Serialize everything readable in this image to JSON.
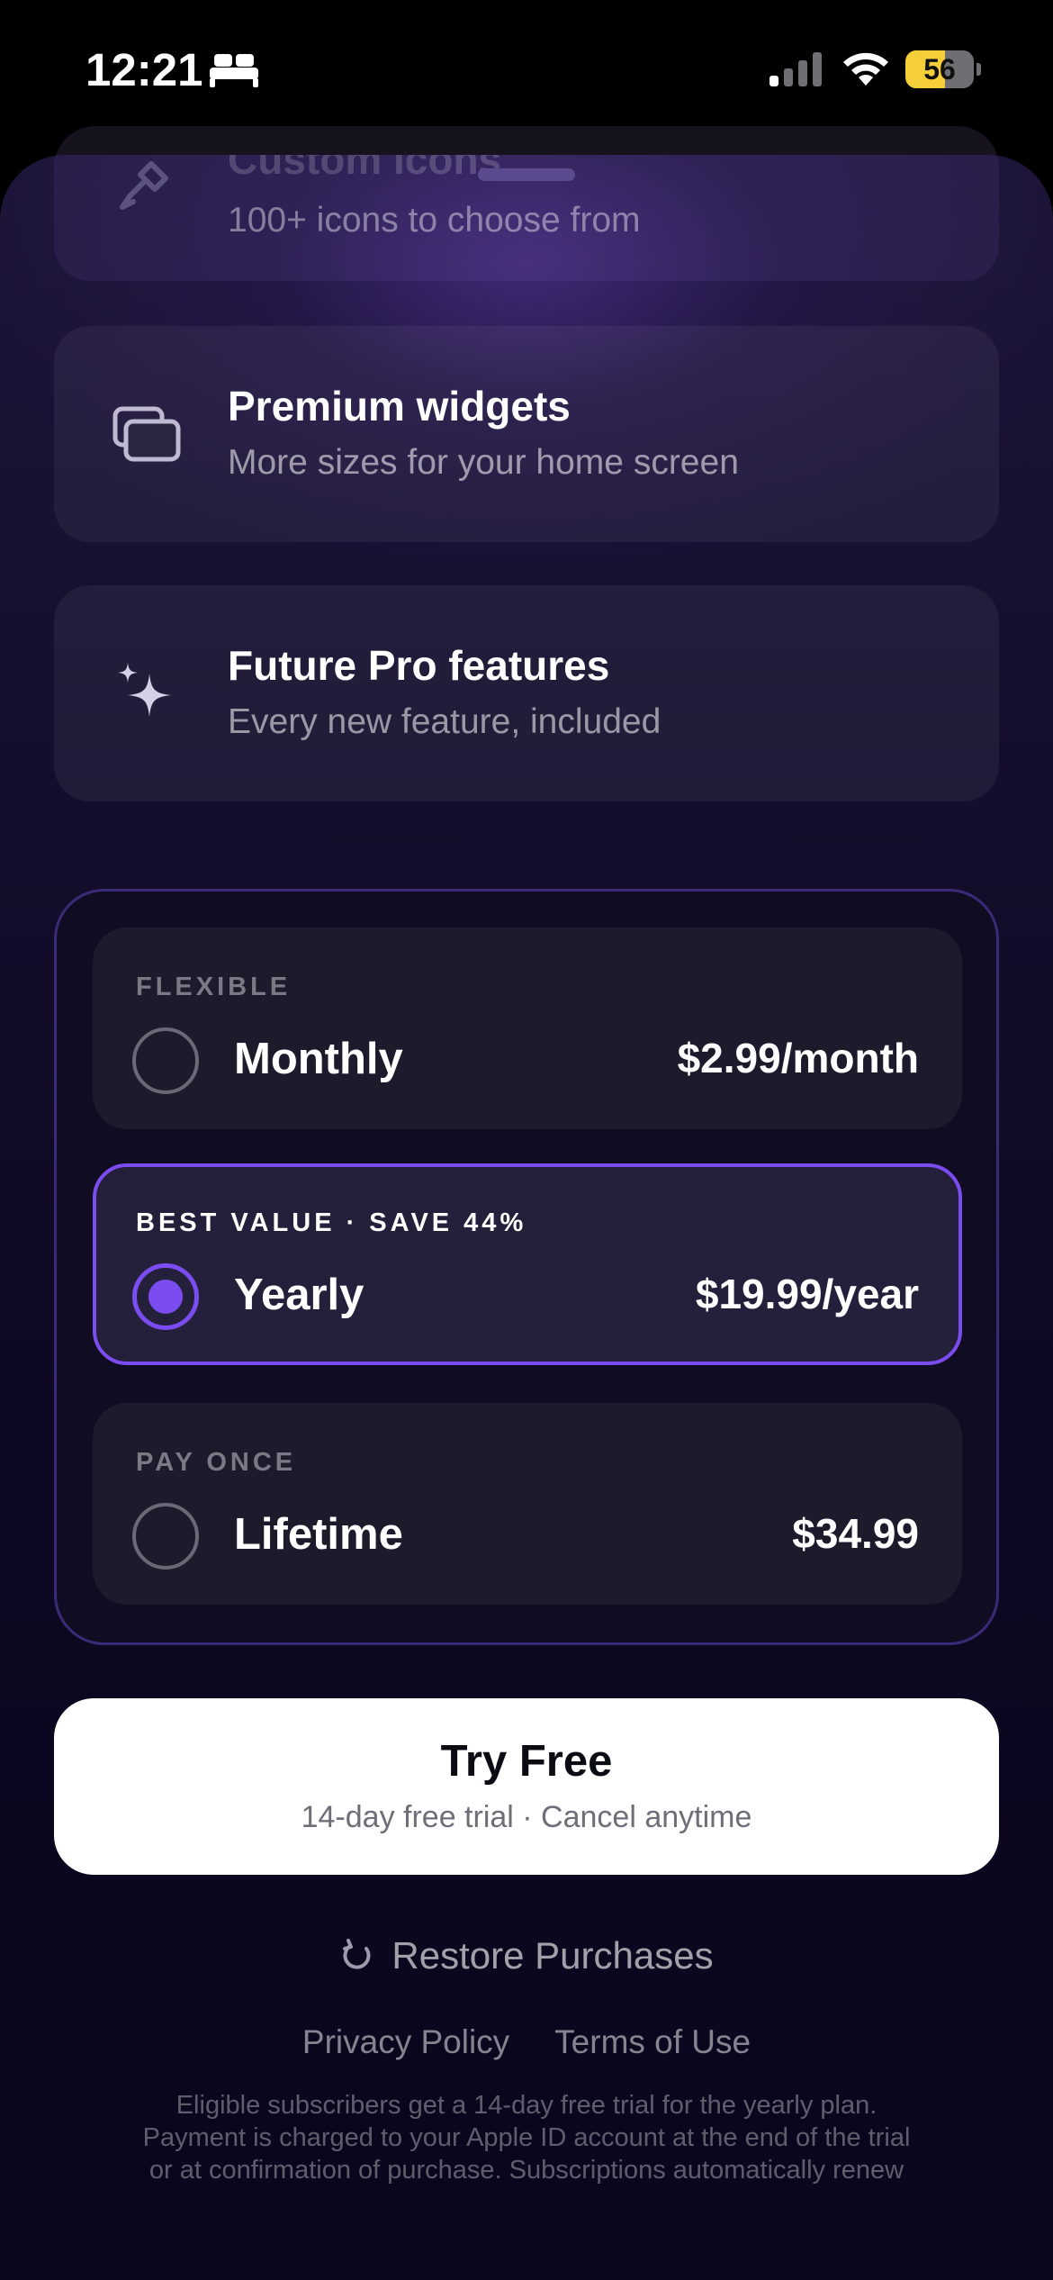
{
  "status_bar": {
    "time": "12:21",
    "battery": "56",
    "icons": [
      "bed-icon",
      "signal-icon",
      "wifi-icon",
      "battery-icon"
    ]
  },
  "features": {
    "custom_icons": {
      "title": "Custom Icons",
      "subtitle": "100+ icons to choose from",
      "icon": "brush-icon"
    },
    "widgets": {
      "title": "Premium widgets",
      "subtitle": "More sizes for your home screen",
      "icon": "widgets-icon"
    },
    "future": {
      "title": "Future Pro features",
      "subtitle": "Every new feature, included",
      "icon": "sparkles-icon"
    }
  },
  "plans": {
    "monthly": {
      "tag": "FLEXIBLE",
      "name": "Monthly",
      "price": "$2.99/month",
      "selected": false
    },
    "yearly": {
      "tag": "BEST VALUE · SAVE 44%",
      "name": "Yearly",
      "price": "$19.99/year",
      "selected": true
    },
    "lifetime": {
      "tag": "PAY ONCE",
      "name": "Lifetime",
      "price": "$34.99",
      "selected": false
    }
  },
  "cta": {
    "title": "Try Free",
    "subtitle": "14-day free trial · Cancel anytime"
  },
  "restore": {
    "label": "Restore Purchases",
    "icon": "refresh-icon"
  },
  "legal": {
    "privacy": "Privacy Policy",
    "terms": "Terms of Use",
    "lines": [
      "Eligible subscribers get a 14-day free trial for the yearly plan.",
      "Payment is charged to your Apple ID account at the end of the trial",
      "or at confirmation of purchase. Subscriptions automatically renew"
    ]
  },
  "colors": {
    "accent": "#7b4cf0",
    "sheet_top": "#1d1538",
    "sheet_bottom": "#0a061c",
    "battery": "#f5cf3a"
  }
}
